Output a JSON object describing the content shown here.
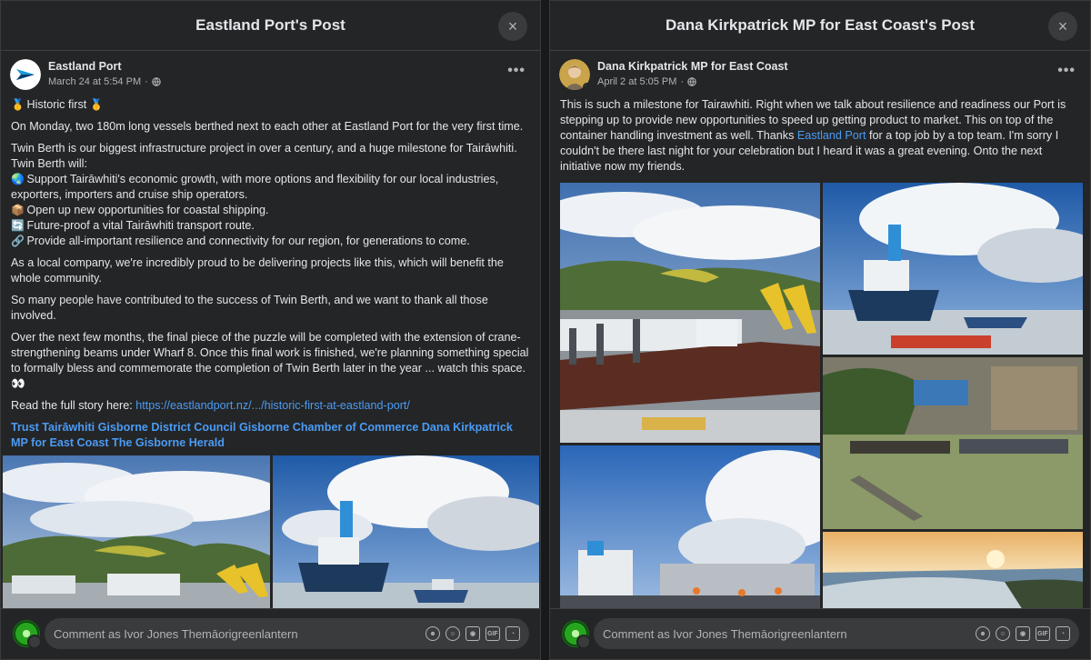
{
  "left": {
    "title": "Eastland Port's Post",
    "author": "Eastland Port",
    "timestamp": "March 24 at 5:54 PM",
    "heading_emoji": "🥇",
    "heading_text": "Historic first",
    "paragraphs": [
      "On Monday, two 180m long vessels berthed next to each other at Eastland Port for the very first time.",
      "Twin Berth is our biggest infrastructure project in over a century, and a huge milestone for Tairāwhiti."
    ],
    "twin_berth_will": "Twin Berth will:",
    "bullets": [
      {
        "icon": "🌏",
        "text": "Support Tairāwhiti's economic growth, with more options and flexibility for our local industries, exporters, importers and cruise ship operators."
      },
      {
        "icon": "📦",
        "text": "Open up new opportunities for coastal shipping."
      },
      {
        "icon": "🔄",
        "text": "Future-proof a vital Tairāwhiti transport route."
      },
      {
        "icon": "🔗",
        "text": "Provide all-important resilience and connectivity for our region, for generations to come."
      }
    ],
    "para3": "As a local company, we're incredibly proud to be delivering projects like this, which will benefit the whole community.",
    "para4": "So many people have contributed to the success of Twin Berth, and we want to thank all those involved.",
    "para5": "Over the next few months, the final piece of the puzzle will be completed with the extension of crane-strengthening beams under Wharf 8. Once this final work is finished, we're planning something special to formally bless and commemorate the completion of Twin Berth later in the year ... watch this space. 👀",
    "read_more_label": "Read the full story here:",
    "read_more_link": "https://eastlandport.nz/.../historic-first-at-eastland-port/",
    "tags": "Trust Tairāwhiti Gisborne District Council Gisborne Chamber of Commerce Dana Kirkpatrick MP for East Coast The Gisborne Herald",
    "comment_placeholder": "Comment as Ivor Jones Themāorigreenlantern"
  },
  "right": {
    "title": "Dana Kirkpatrick MP for East Coast's Post",
    "author": "Dana Kirkpatrick MP for East Coast",
    "timestamp": "April 2 at 5:05 PM",
    "body_pre": "This is such a milestone for Tairawhiti.  Right when we talk about resilience and readiness our Port is stepping up to provide new opportunities to speed up getting product to market.  This on top of the container handling investment as well. Thanks ",
    "body_link": "Eastland Port",
    "body_post": " for a top job by a top team.  I'm sorry I couldn't be there last night for your celebration but I heard it was a great evening.  Onto the next initiative now my friends.",
    "comment_placeholder": "Comment as Ivor Jones Themāorigreenlantern"
  },
  "icons": {
    "close": "×",
    "more": "•••",
    "globe": "globe-icon"
  }
}
